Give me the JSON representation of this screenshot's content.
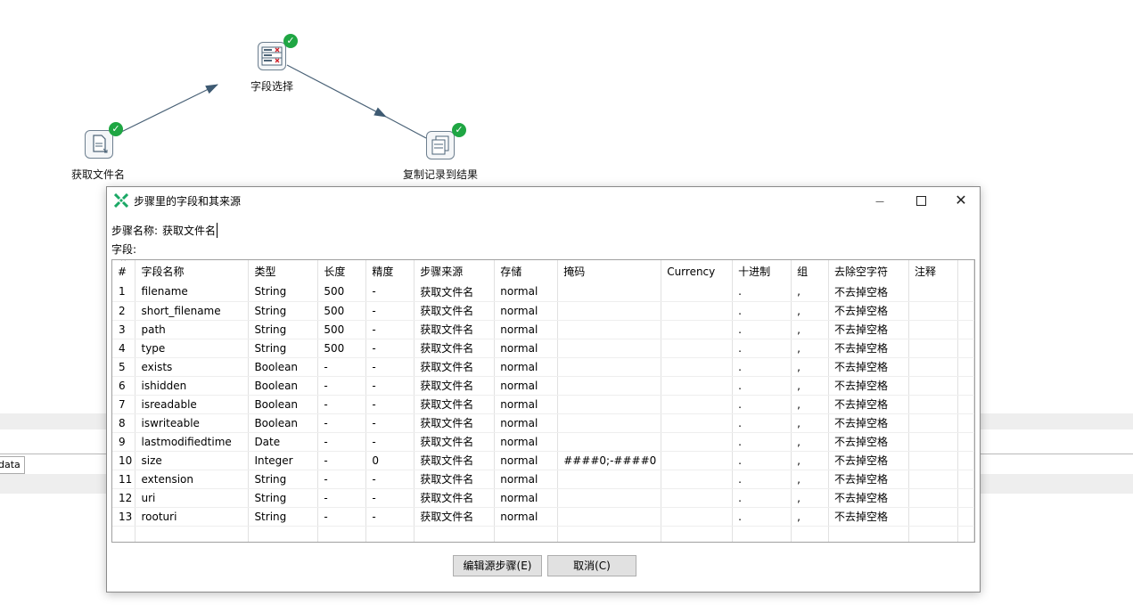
{
  "canvas": {
    "nodes": [
      {
        "label": "获取文件名",
        "icon": "get-file-names-icon"
      },
      {
        "label": "字段选择",
        "icon": "select-values-icon"
      },
      {
        "label": "复制记录到结果",
        "icon": "copy-rows-to-result-icon"
      }
    ],
    "background_tab": "data"
  },
  "dialog": {
    "title": "步骤里的字段和其来源",
    "step_name_label": "步骤名称:",
    "step_name_value": "获取文件名",
    "fields_label": "字段:",
    "columns": [
      "#",
      "字段名称",
      "类型",
      "长度",
      "精度",
      "步骤来源",
      "存储",
      "掩码",
      "Currency",
      "十进制",
      "组",
      "去除空字符",
      "注释"
    ],
    "rows": [
      [
        "1",
        "filename",
        "String",
        "500",
        "-",
        "获取文件名",
        "normal",
        "",
        "",
        ".",
        ",",
        "不去掉空格",
        ""
      ],
      [
        "2",
        "short_filename",
        "String",
        "500",
        "-",
        "获取文件名",
        "normal",
        "",
        "",
        ".",
        ",",
        "不去掉空格",
        ""
      ],
      [
        "3",
        "path",
        "String",
        "500",
        "-",
        "获取文件名",
        "normal",
        "",
        "",
        ".",
        ",",
        "不去掉空格",
        ""
      ],
      [
        "4",
        "type",
        "String",
        "500",
        "-",
        "获取文件名",
        "normal",
        "",
        "",
        ".",
        ",",
        "不去掉空格",
        ""
      ],
      [
        "5",
        "exists",
        "Boolean",
        "-",
        "-",
        "获取文件名",
        "normal",
        "",
        "",
        ".",
        ",",
        "不去掉空格",
        ""
      ],
      [
        "6",
        "ishidden",
        "Boolean",
        "-",
        "-",
        "获取文件名",
        "normal",
        "",
        "",
        ".",
        ",",
        "不去掉空格",
        ""
      ],
      [
        "7",
        "isreadable",
        "Boolean",
        "-",
        "-",
        "获取文件名",
        "normal",
        "",
        "",
        ".",
        ",",
        "不去掉空格",
        ""
      ],
      [
        "8",
        "iswriteable",
        "Boolean",
        "-",
        "-",
        "获取文件名",
        "normal",
        "",
        "",
        ".",
        ",",
        "不去掉空格",
        ""
      ],
      [
        "9",
        "lastmodifiedtime",
        "Date",
        "-",
        "-",
        "获取文件名",
        "normal",
        "",
        "",
        ".",
        ",",
        "不去掉空格",
        ""
      ],
      [
        "10",
        "size",
        "Integer",
        "-",
        "0",
        "获取文件名",
        "normal",
        "####0;-####0",
        "",
        ".",
        ",",
        "不去掉空格",
        ""
      ],
      [
        "11",
        "extension",
        "String",
        "-",
        "-",
        "获取文件名",
        "normal",
        "",
        "",
        ".",
        ",",
        "不去掉空格",
        ""
      ],
      [
        "12",
        "uri",
        "String",
        "-",
        "-",
        "获取文件名",
        "normal",
        "",
        "",
        ".",
        ",",
        "不去掉空格",
        ""
      ],
      [
        "13",
        "rooturi",
        "String",
        "-",
        "-",
        "获取文件名",
        "normal",
        "",
        "",
        ".",
        ",",
        "不去掉空格",
        ""
      ]
    ],
    "buttons": {
      "edit_source": "编辑源步骤(E)",
      "cancel": "取消(C)"
    },
    "window_controls": {
      "minimize": "—",
      "close": "✕"
    }
  }
}
